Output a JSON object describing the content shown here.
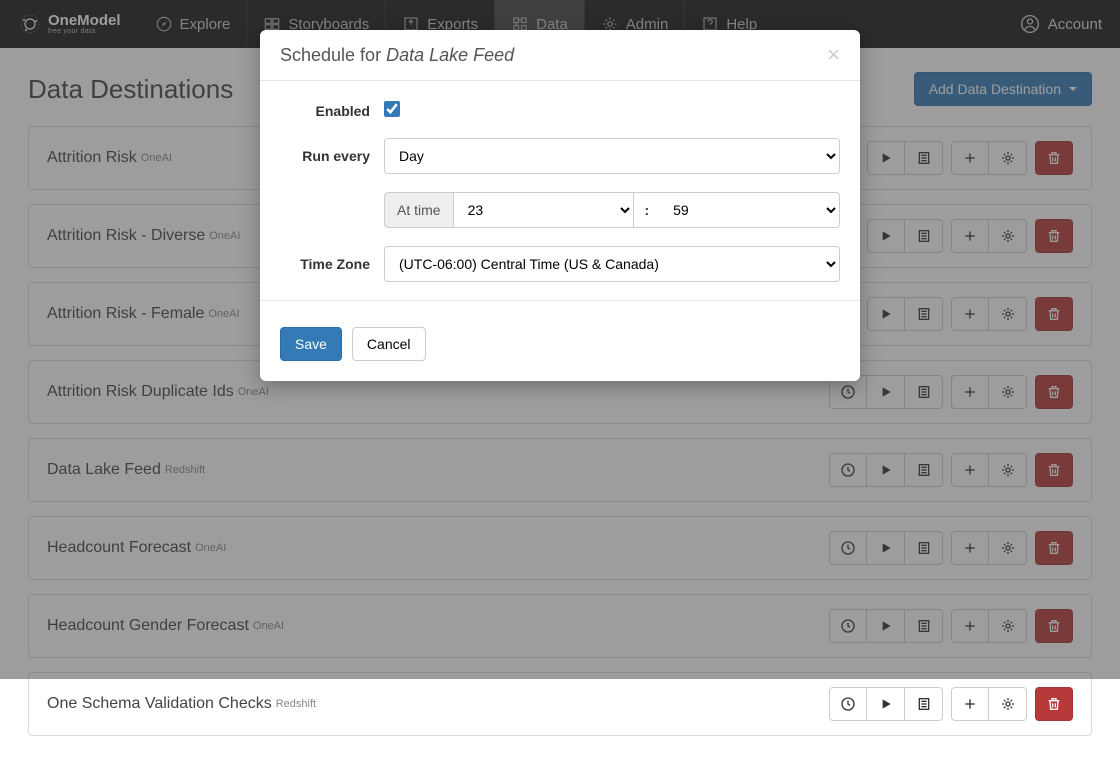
{
  "brand": {
    "name": "OneModel",
    "tag": "free your data"
  },
  "nav": {
    "items": [
      {
        "label": "Explore"
      },
      {
        "label": "Storyboards"
      },
      {
        "label": "Exports"
      },
      {
        "label": "Data",
        "active": true
      },
      {
        "label": "Admin"
      },
      {
        "label": "Help"
      }
    ],
    "account": "Account"
  },
  "page": {
    "title": "Data Destinations",
    "addButton": "Add Data Destination"
  },
  "destinations": [
    {
      "name": "Attrition Risk",
      "type": "OneAI",
      "hasSchedule": false
    },
    {
      "name": "Attrition Risk - Diverse",
      "type": "OneAI",
      "hasSchedule": false
    },
    {
      "name": "Attrition Risk - Female",
      "type": "OneAI",
      "hasSchedule": false
    },
    {
      "name": "Attrition Risk Duplicate Ids",
      "type": "OneAI",
      "hasSchedule": true
    },
    {
      "name": "Data Lake Feed",
      "type": "Redshift",
      "hasSchedule": true
    },
    {
      "name": "Headcount Forecast",
      "type": "OneAI",
      "hasSchedule": true
    },
    {
      "name": "Headcount Gender Forecast",
      "type": "OneAI",
      "hasSchedule": true
    },
    {
      "name": "One Schema Validation Checks",
      "type": "Redshift",
      "hasSchedule": true
    }
  ],
  "modal": {
    "titlePrefix": "Schedule for ",
    "titleSubject": "Data Lake Feed",
    "labels": {
      "enabled": "Enabled",
      "runEvery": "Run every",
      "atTime": "At time",
      "colon": ":",
      "timeZone": "Time Zone"
    },
    "values": {
      "enabled": true,
      "runEvery": "Day",
      "hour": "23",
      "minute": "59",
      "timeZone": "(UTC-06:00) Central Time (US & Canada)"
    },
    "buttons": {
      "save": "Save",
      "cancel": "Cancel"
    }
  }
}
